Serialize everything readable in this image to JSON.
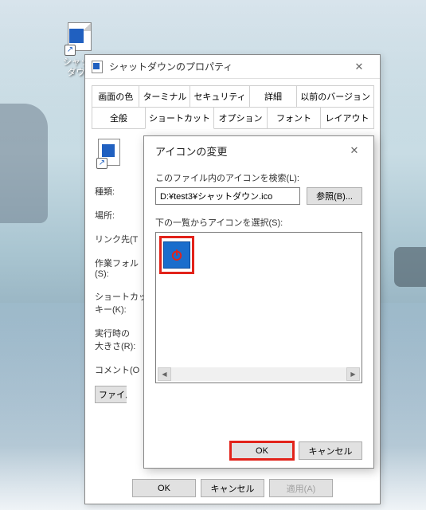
{
  "desktop": {
    "shortcut_label": "シャット\nダウン"
  },
  "props": {
    "title": "シャットダウンのプロパティ",
    "tabs_row1": [
      "画面の色",
      "ターミナル",
      "セキュリティ",
      "詳細",
      "以前のバージョン"
    ],
    "tabs_row2": [
      "全般",
      "ショートカット",
      "オプション",
      "フォント",
      "レイアウト"
    ],
    "active_tab_index": 1,
    "fields": {
      "type": "種類:",
      "location": "場所:",
      "target": "リンク先(T",
      "startin": "作業フォル\n(S):",
      "hotkey": "ショートカッ\nキー(K):",
      "run": "実行時の\n大きさ(R):",
      "comment": "コメント(O",
      "file_location_btn": "ファイル"
    },
    "buttons": {
      "ok": "OK",
      "cancel": "キャンセル",
      "apply": "適用(A)"
    }
  },
  "icondlg": {
    "title": "アイコンの変更",
    "search_label": "このファイル内のアイコンを検索(L):",
    "path": "D:¥test3¥シャットダウン.ico",
    "browse": "参照(B)...",
    "list_label": "下の一覧からアイコンを選択(S):",
    "ok": "OK",
    "cancel": "キャンセル"
  }
}
